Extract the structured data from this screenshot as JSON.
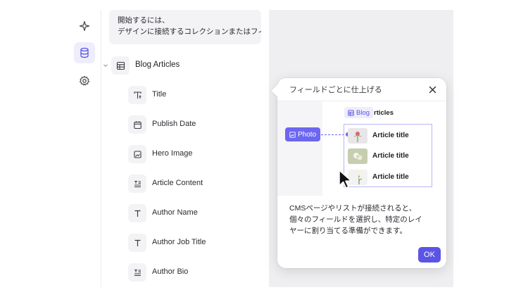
{
  "hint": {
    "line1": "開始するには、",
    "line2": "デザインに接続するコレクションまたはフィ"
  },
  "collection": {
    "label": "Blog Articles"
  },
  "fields": [
    {
      "label": "Title",
      "icon": "title-field-icon"
    },
    {
      "label": "Publish Date",
      "icon": "calendar-icon"
    },
    {
      "label": "Hero Image",
      "icon": "image-icon"
    },
    {
      "label": "Article Content",
      "icon": "rich-text-icon"
    },
    {
      "label": "Author Name",
      "icon": "text-icon"
    },
    {
      "label": "Author Job Title",
      "icon": "text-icon"
    },
    {
      "label": "Author Bio",
      "icon": "rich-text-icon"
    }
  ],
  "popover": {
    "title": "フィールドごとに仕上げる",
    "illustration": {
      "blog_chip": "Blog",
      "blog_suffix": "rticles",
      "photo_chip": "Photo",
      "articles": [
        "Article title",
        "Article title",
        "Article title"
      ]
    },
    "description": [
      "CMSページやリストが接続されると、",
      "個々のフィールドを選択し、特定のレイ",
      "ヤーに割り当てる準備ができます。"
    ],
    "ok_label": "OK"
  },
  "colors": {
    "accent": "#5b55e6",
    "accent_light": "#eeedfc",
    "canvas": "#efeff1"
  }
}
